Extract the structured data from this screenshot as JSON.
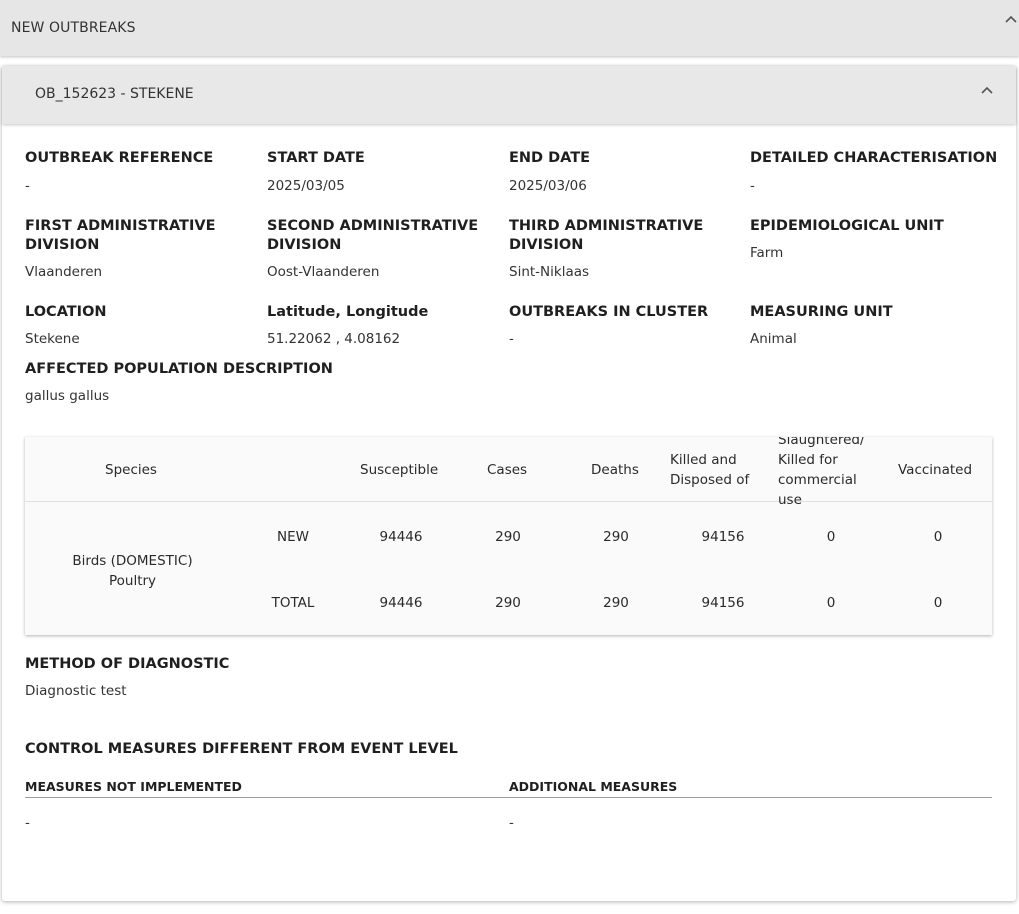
{
  "top_panel": {
    "title": "NEW OUTBREAKS"
  },
  "outbreak": {
    "title": "OB_152623 - STEKENE",
    "fields": {
      "outbreak_reference": {
        "label": "OUTBREAK REFERENCE",
        "value": "-"
      },
      "start_date": {
        "label": "START DATE",
        "value": "2025/03/05"
      },
      "end_date": {
        "label": "END DATE",
        "value": "2025/03/06"
      },
      "detailed_characterisation": {
        "label": "DETAILED CHARACTERISATION",
        "value": "-"
      },
      "first_admin": {
        "label": "FIRST ADMINISTRATIVE DIVISION",
        "value": "Vlaanderen"
      },
      "second_admin": {
        "label": "SECOND ADMINISTRATIVE DIVISION",
        "value": "Oost-Vlaanderen"
      },
      "third_admin": {
        "label": "THIRD ADMINISTRATIVE DIVISION",
        "value": "Sint-Niklaas"
      },
      "epi_unit": {
        "label": "EPIDEMIOLOGICAL UNIT",
        "value": "Farm"
      },
      "location": {
        "label": "LOCATION",
        "value": "Stekene"
      },
      "lat_long": {
        "label": "Latitude, Longitude",
        "value": "51.22062 , 4.08162"
      },
      "outbreaks_in_cluster": {
        "label": "OUTBREAKS IN CLUSTER",
        "value": "-"
      },
      "measuring_unit": {
        "label": "MEASURING UNIT",
        "value": "Animal"
      },
      "affected_population": {
        "label": "AFFECTED POPULATION DESCRIPTION",
        "value": "gallus gallus"
      }
    },
    "table": {
      "headers": {
        "species": "Species",
        "susceptible": "Susceptible",
        "cases": "Cases",
        "deaths": "Deaths",
        "killed_disposed": "Killed and Disposed of",
        "slaughtered": "Slaughtered/ Killed for commercial use",
        "vaccinated": "Vaccinated"
      },
      "species": "Birds (DOMESTIC) Poultry",
      "rows": [
        {
          "type": "NEW",
          "susceptible": "94446",
          "cases": "290",
          "deaths": "290",
          "killed_disposed": "94156",
          "slaughtered": "0",
          "vaccinated": "0"
        },
        {
          "type": "TOTAL",
          "susceptible": "94446",
          "cases": "290",
          "deaths": "290",
          "killed_disposed": "94156",
          "slaughtered": "0",
          "vaccinated": "0"
        }
      ]
    },
    "method_of_diagnostic": {
      "label": "METHOD OF DIAGNOSTIC",
      "value": "Diagnostic test"
    },
    "control_measures": {
      "title": "CONTROL MEASURES DIFFERENT FROM EVENT LEVEL",
      "not_implemented": {
        "label": "MEASURES NOT IMPLEMENTED",
        "value": "-"
      },
      "additional": {
        "label": "ADDITIONAL MEASURES",
        "value": "-"
      }
    }
  },
  "icons": {
    "collapse": "chevron-up-icon"
  }
}
